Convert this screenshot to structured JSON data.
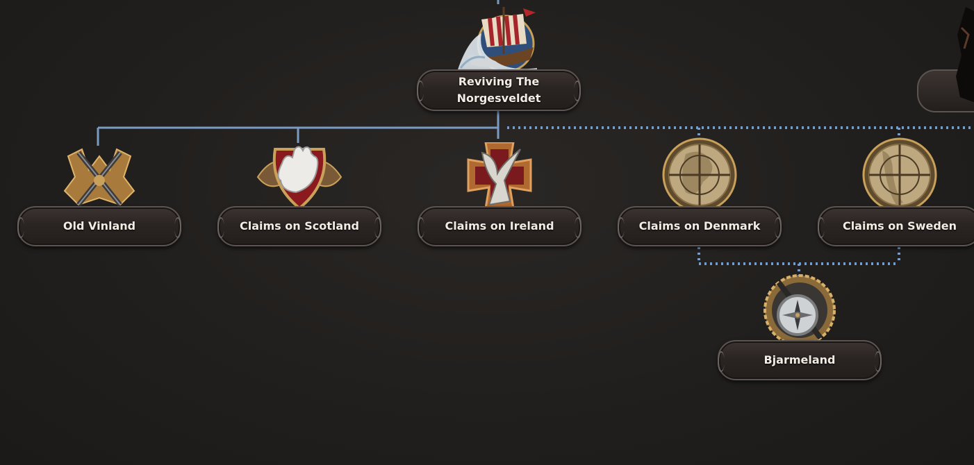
{
  "focus_tree": {
    "root": {
      "label": "Reviving The Norgesveldet",
      "icon": "viking-longship-icon"
    },
    "branches": [
      {
        "label": "Old Vinland",
        "icon": "crossed-swords-icon"
      },
      {
        "label": "Claims on Scotland",
        "icon": "grasping-hand-icon"
      },
      {
        "label": "Claims on Ireland",
        "icon": "eagle-cross-icon"
      },
      {
        "label": "Claims on Denmark",
        "icon": "crosshair-map-icon"
      },
      {
        "label": "Claims on Sweden",
        "icon": "crosshair-map-icon"
      }
    ],
    "child": {
      "label": "Bjarmeland",
      "icon": "compass-icon"
    }
  },
  "colors": {
    "background": "#211f1d",
    "connector": "#7a9bc4",
    "plate": "#2a2422",
    "gold": "#c9a15a"
  }
}
